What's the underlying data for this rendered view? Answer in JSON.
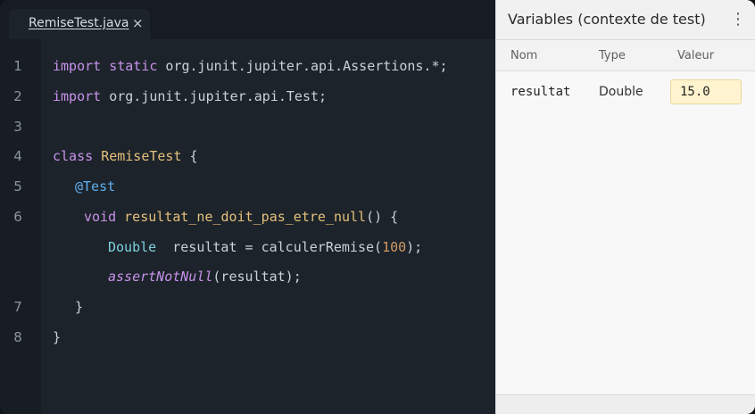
{
  "editor": {
    "tab": {
      "label": "RemiseTest.java",
      "close_glyph": "×"
    },
    "gutter": [
      "1",
      "2",
      "3",
      "4",
      "5",
      "6",
      "",
      "",
      "7",
      "8"
    ],
    "code": {
      "l1_kw1": "import",
      "l1_kw2": "static",
      "l1_rest": " org.junit.jupiter.api.Assertions.*;",
      "l2_kw": "import",
      "l2_rest": " org.junit.jupiter.api.Test;",
      "l4_kw": "class",
      "l4_cls": "RemiseTest",
      "l4_rest": " {",
      "l5_ann": "@Test",
      "l6_kw": "void",
      "l6_fn": "resultat_ne_doit_pas_etre_null",
      "l6_rest": "() {",
      "l7_type": "Double",
      "l7_mid": "  resultat = calculerRemise(",
      "l7_num": "100",
      "l7_end": ");",
      "l8_fn": "assertNotNull",
      "l8_rest": "(resultat);",
      "l9": "}",
      "l10": "}"
    }
  },
  "panel": {
    "title": "Variables (contexte de test)",
    "menu_glyph": "⋮",
    "columns": {
      "name": "Nom",
      "type": "Type",
      "value": "Valeur"
    },
    "variables": [
      {
        "name": "resultat",
        "type": "Double",
        "value": "15.0"
      }
    ]
  },
  "colors": {
    "editor_bg": "#1c232a",
    "keyword": "#c792ea",
    "class_name": "#e5c07b",
    "annotation": "#61afef",
    "number": "#d19a66",
    "value_highlight": "#fff4cf"
  }
}
